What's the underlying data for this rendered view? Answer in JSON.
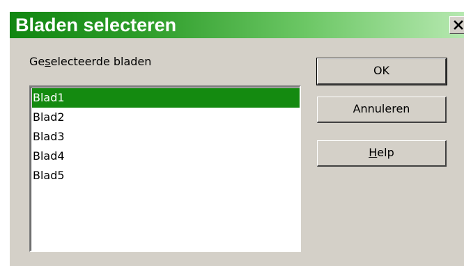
{
  "dialog": {
    "title": "Bladen selecteren",
    "close_label": "close",
    "selected_sheets_label": "Geselecteerde bladen",
    "sheets": [
      {
        "name": "Blad1",
        "selected": true
      },
      {
        "name": "Blad2",
        "selected": false
      },
      {
        "name": "Blad3",
        "selected": false
      },
      {
        "name": "Blad4",
        "selected": false
      },
      {
        "name": "Blad5",
        "selected": false
      }
    ],
    "buttons": {
      "ok": "OK",
      "cancel": "Annuleren",
      "help": "Help"
    }
  },
  "colors": {
    "title_gradient_start": "#118611",
    "title_gradient_end": "#b6e8b0",
    "selection": "#148a10",
    "dialog_face": "#d4d0c8"
  },
  "icons": {
    "close": "close-icon"
  }
}
